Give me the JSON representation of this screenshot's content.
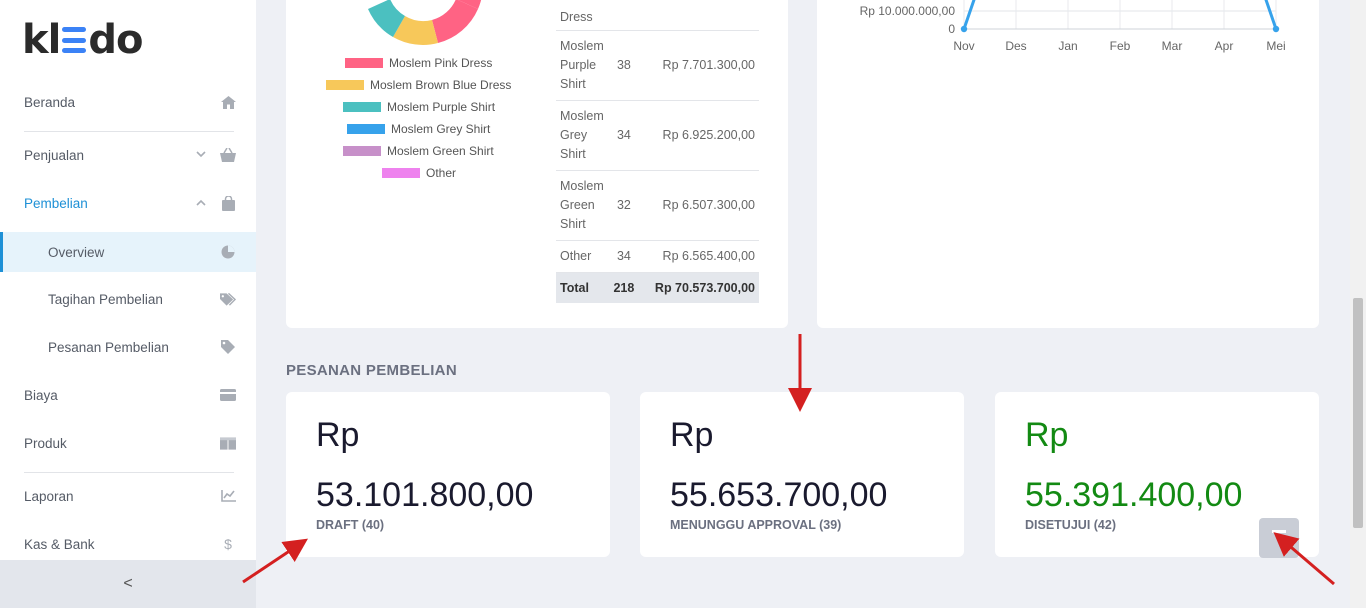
{
  "sidebar": {
    "logo": "kledo",
    "items": [
      {
        "label": "Beranda",
        "icon": "home-icon"
      },
      {
        "label": "Penjualan",
        "icon": "basket-icon"
      },
      {
        "label": "Pembelian",
        "icon": "bag-icon"
      },
      {
        "label": "Overview",
        "icon": "pie-chart-icon"
      },
      {
        "label": "Tagihan Pembelian",
        "icon": "tags-icon"
      },
      {
        "label": "Pesanan Pembelian",
        "icon": "tag-icon"
      },
      {
        "label": "Biaya",
        "icon": "credit-card-icon"
      },
      {
        "label": "Produk",
        "icon": "boxes-icon"
      },
      {
        "label": "Laporan",
        "icon": "line-chart-icon"
      },
      {
        "label": "Kas & Bank",
        "icon": "dollar-icon"
      }
    ],
    "collapse_glyph": "<"
  },
  "donut_legend": [
    {
      "label": "Moslem Pink Dress",
      "color": "#ff6384"
    },
    {
      "label": "Moslem Brown Blue Dress",
      "color": "#f7c85a"
    },
    {
      "label": "Moslem Purple Shirt",
      "color": "#4bc0c0"
    },
    {
      "label": "Moslem Grey Shirt",
      "color": "#36a2eb"
    },
    {
      "label": "Moslem Green Shirt",
      "color": "#c790c9"
    },
    {
      "label": "Other",
      "color": "#ee82ee"
    }
  ],
  "product_table": {
    "rows": [
      {
        "name": "Dress",
        "qty": "",
        "amount": ""
      },
      {
        "name": "Moslem Purple Shirt",
        "qty": "38",
        "amount": "Rp 7.701.300,00"
      },
      {
        "name": "Moslem Grey Shirt",
        "qty": "34",
        "amount": "Rp 6.925.200,00"
      },
      {
        "name": "Moslem Green Shirt",
        "qty": "32",
        "amount": "Rp 6.507.300,00"
      },
      {
        "name": "Other",
        "qty": "34",
        "amount": "Rp 6.565.400,00"
      }
    ],
    "total": {
      "label": "Total",
      "qty": "218",
      "amount": "Rp 70.573.700,00"
    }
  },
  "chart_data": {
    "type": "line",
    "categories": [
      "Nov",
      "Des",
      "Jan",
      "Feb",
      "Mar",
      "Apr",
      "Mei"
    ],
    "y_ticks": [
      "Rp 10.000.000,00",
      "0"
    ]
  },
  "section": {
    "title": "PESANAN PEMBELIAN"
  },
  "kpis": [
    {
      "currency": "Rp",
      "value": "53.101.800,00",
      "label": "DRAFT (40)"
    },
    {
      "currency": "Rp",
      "value": "55.653.700,00",
      "label": "MENUNGGU APPROVAL (39)"
    },
    {
      "currency": "Rp",
      "value": "55.391.400,00",
      "label": "DISETUJUI (42)"
    }
  ],
  "colors": {
    "accent": "#1e90d6",
    "approved": "#138a13",
    "annotation_arrow": "#d42020"
  }
}
